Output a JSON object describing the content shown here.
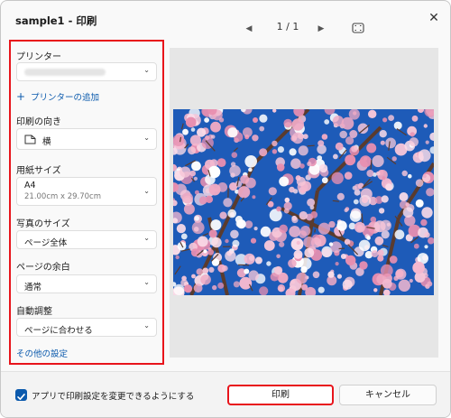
{
  "window": {
    "title": "sample1 - 印刷",
    "close_glyph": "✕"
  },
  "nav": {
    "prev_glyph": "◀",
    "page": "1 / 1",
    "next_glyph": "▶",
    "fullscreen_icon": "fullscreen-icon"
  },
  "settings": {
    "printer_label": "プリンター",
    "add_printer": "プリンターの追加",
    "orientation_label": "印刷の向き",
    "orientation_value": "横",
    "paper_size_label": "用紙サイズ",
    "paper_size_value": "A4",
    "paper_size_detail": "21.00cm x 29.70cm",
    "photo_size_label": "写真のサイズ",
    "photo_size_value": "ページ全体",
    "margin_label": "ページの余白",
    "margin_value": "通常",
    "auto_adjust_label": "自動調整",
    "auto_adjust_value": "ページに合わせる",
    "more_settings": "その他の設定"
  },
  "footer": {
    "allow_app_settings": "アプリで印刷設定を変更できるようにする",
    "allow_app_settings_checked": true,
    "print_button": "印刷",
    "cancel_button": "キャンセル"
  },
  "colors": {
    "accent": "#0b5aad",
    "highlight": "#e8141b",
    "sky": "#1e5bb8",
    "blossom": "#f2b6cc",
    "branch": "#5a3b2e"
  },
  "icons": [
    "close-icon",
    "chevron-left-icon",
    "chevron-right-icon",
    "fullscreen-icon",
    "chevron-down-icon",
    "plus-icon",
    "page-orientation-icon",
    "checkmark-icon"
  ]
}
